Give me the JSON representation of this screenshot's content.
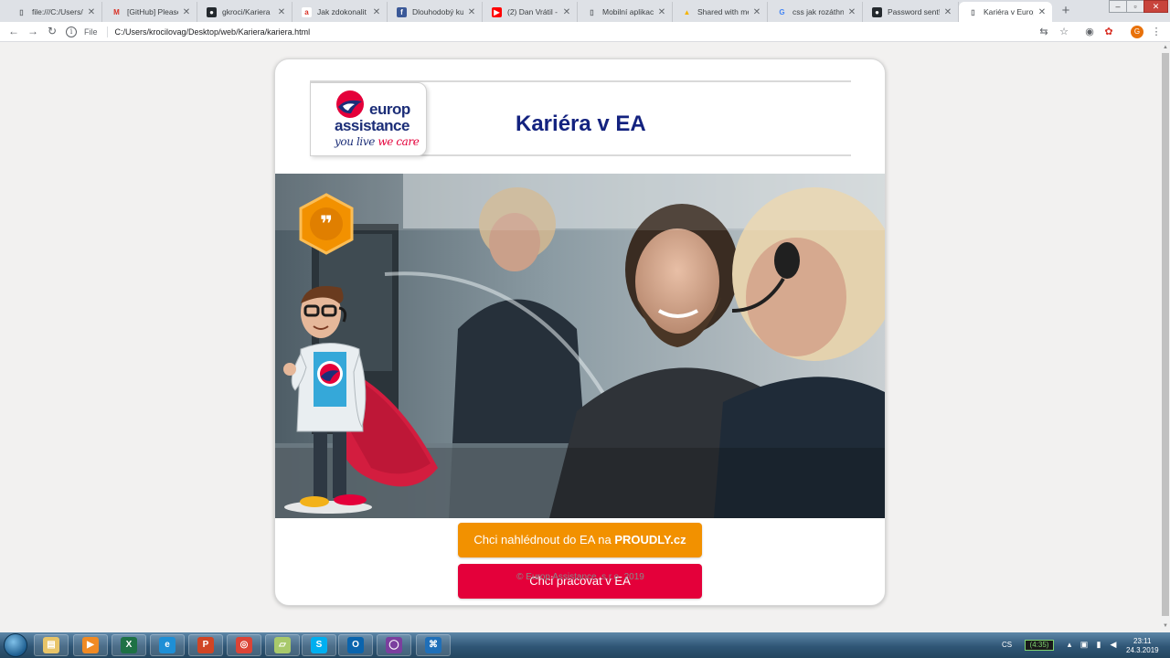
{
  "browser": {
    "tabs": [
      {
        "title": "file:///C:/Users/kr",
        "favicon": "file-icon",
        "active": false
      },
      {
        "title": "[GitHub] Please ve",
        "favicon": "gmail-icon",
        "active": false
      },
      {
        "title": "gkroci/Kariera",
        "favicon": "github-icon",
        "active": false
      },
      {
        "title": "Jak zdokonalit on",
        "favicon": "pdf-icon",
        "active": false
      },
      {
        "title": "Dlouhodobý kurs",
        "favicon": "facebook-icon",
        "active": false
      },
      {
        "title": "(2) Dan Vrátil - Yo",
        "favicon": "youtube-icon",
        "active": false
      },
      {
        "title": "Mobilní aplikace",
        "favicon": "file-icon",
        "active": false
      },
      {
        "title": "Shared with me -",
        "favicon": "drive-icon",
        "active": false
      },
      {
        "title": "css jak rozáthnou",
        "favicon": "google-icon",
        "active": false
      },
      {
        "title": "Password sent! -",
        "favicon": "github-icon",
        "active": false
      },
      {
        "title": "Kariéra v Europ A",
        "favicon": "file-icon",
        "active": true
      }
    ],
    "new_tab": "+",
    "address": {
      "scheme_label": "File",
      "url": "C:/Users/krocilovag/Desktop/web/Kariera/kariera.html"
    },
    "profile_initial": "G"
  },
  "page": {
    "logo": {
      "line1": "europ",
      "line2": "assistance",
      "tagline_a": "you live ",
      "tagline_b": "we care"
    },
    "title": "Kariéra v EA",
    "buttons": {
      "proudly_prefix": "Chci nahlédnout do EA na ",
      "proudly_bold": "PROUDLY",
      "proudly_suffix": ".cz",
      "work": "Chci pracovat v EA"
    },
    "footer": "© Europ Assistance, s.r.o. 2019"
  },
  "taskbar": {
    "apps": [
      "explorer-icon",
      "media-player-icon",
      "excel-icon",
      "ie-icon",
      "powerpoint-icon",
      "chrome-icon",
      "folder-icon",
      "skype-icon",
      "outlook-icon",
      "onenote-icon",
      "vscode-icon"
    ],
    "language": "CS",
    "battery": "(4:35)",
    "time": "23:11",
    "date": "24.3.2019"
  },
  "colors": {
    "brand_navy": "#13227f",
    "brand_red": "#e4003a",
    "accent_orange": "#f29100"
  }
}
